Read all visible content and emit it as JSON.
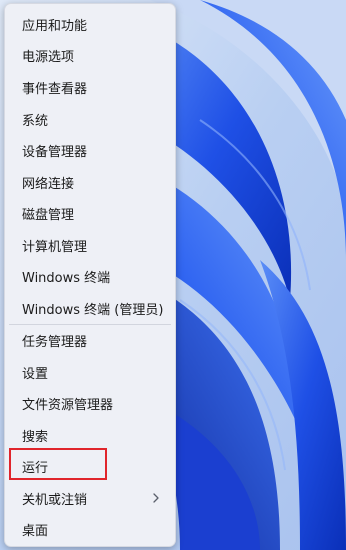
{
  "menu": {
    "items": [
      {
        "label": "应用和功能"
      },
      {
        "label": "电源选项"
      },
      {
        "label": "事件查看器"
      },
      {
        "label": "系统"
      },
      {
        "label": "设备管理器"
      },
      {
        "label": "网络连接"
      },
      {
        "label": "磁盘管理"
      },
      {
        "label": "计算机管理"
      },
      {
        "label": "Windows 终端"
      },
      {
        "label": "Windows 终端 (管理员)"
      },
      {
        "label": "任务管理器"
      },
      {
        "label": "设置"
      },
      {
        "label": "文件资源管理器"
      },
      {
        "label": "搜索"
      },
      {
        "label": "运行"
      },
      {
        "label": "关机或注销",
        "submenu_icon": "chevron-right-icon"
      },
      {
        "label": "桌面"
      }
    ],
    "highlighted_item": "运行",
    "highlight_color": "#e0252b",
    "background_color": "#eef0f6"
  },
  "desktop": {
    "wallpaper": "Windows 11 blue bloom",
    "accent_color": "#1a4fe0"
  }
}
